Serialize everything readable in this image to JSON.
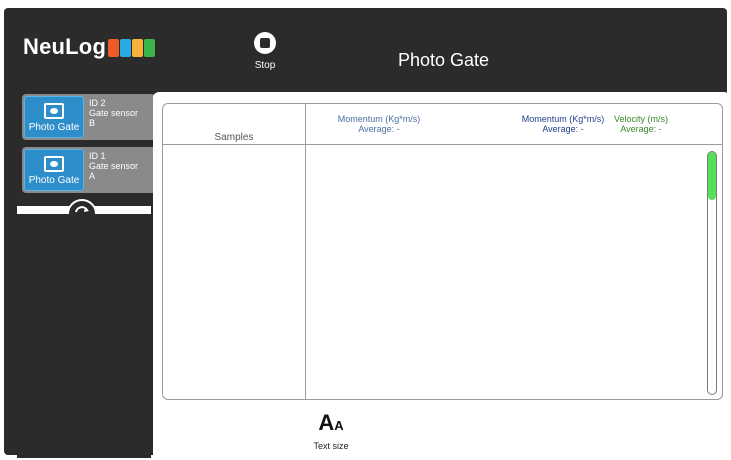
{
  "header": {
    "logo_text": "NeuLog",
    "logo_colors": [
      "#f15a24",
      "#29abe2",
      "#fbb03b",
      "#39b54a"
    ],
    "stop_label": "Stop",
    "title": "Photo Gate"
  },
  "sensors": [
    {
      "name": "Photo Gate",
      "id": "ID 2",
      "type": "Gate sensor",
      "letter": "B"
    },
    {
      "name": "Photo Gate",
      "id": "ID 1",
      "type": "Gate sensor",
      "letter": "A"
    }
  ],
  "table": {
    "samples_header": "Samples",
    "columns": [
      {
        "title": "Momentum (Kg*m/s)",
        "average": "Average: -",
        "color": "#4a6fa5"
      },
      {
        "title": "Momentum (Kg*m/s)",
        "average": "Average: -",
        "color": "#1f3f8c"
      },
      {
        "title": "Velocity (m/s)",
        "average": "Average: -",
        "color": "#3a8a2a"
      }
    ]
  },
  "footer": {
    "text_size_label": "Text size"
  },
  "colors": {
    "accent_blue": "#2e8ec9",
    "scroll_green": "#55e05a",
    "frame": "#2b2b2b"
  }
}
